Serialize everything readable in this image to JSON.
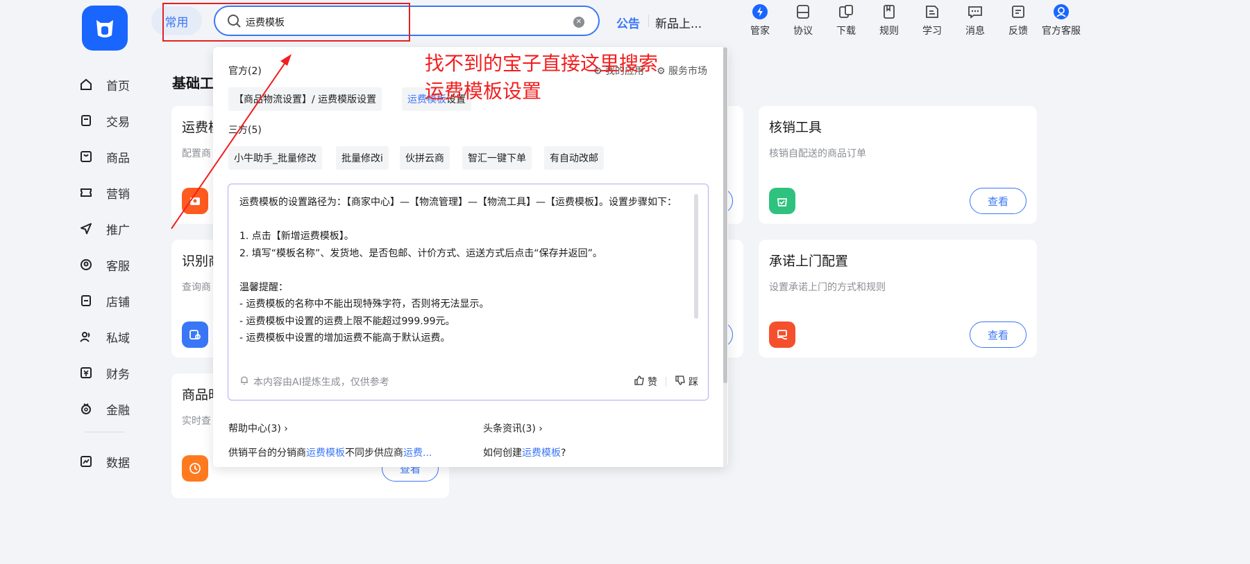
{
  "sidebar": {
    "items": [
      {
        "label": "首页",
        "icon": "home-icon"
      },
      {
        "label": "交易",
        "icon": "order-icon"
      },
      {
        "label": "商品",
        "icon": "product-icon"
      },
      {
        "label": "营销",
        "icon": "ticket-icon"
      },
      {
        "label": "推广",
        "icon": "send-icon"
      },
      {
        "label": "客服",
        "icon": "service-icon"
      },
      {
        "label": "店铺",
        "icon": "store-icon"
      },
      {
        "label": "私域",
        "icon": "people-icon"
      },
      {
        "label": "财务",
        "icon": "finance-icon"
      },
      {
        "label": "金融",
        "icon": "money-bag-icon"
      },
      {
        "label": "数据",
        "icon": "chart-icon"
      }
    ]
  },
  "topbar": {
    "common_tab": "常用",
    "search_value": "运费模板",
    "notice_label": "公告",
    "notice_text": "新品上...",
    "tools": [
      {
        "label": "管家",
        "icon": "butler-icon"
      },
      {
        "label": "协议",
        "icon": "agreement-icon"
      },
      {
        "label": "下载",
        "icon": "download-icon"
      },
      {
        "label": "规则",
        "icon": "rules-icon"
      },
      {
        "label": "学习",
        "icon": "learn-icon"
      },
      {
        "label": "消息",
        "icon": "message-icon"
      },
      {
        "label": "反馈",
        "icon": "feedback-icon"
      },
      {
        "label": "官方客服",
        "icon": "official-service-icon"
      }
    ]
  },
  "main": {
    "section_title": "基础工",
    "cards": [
      {
        "title": "运费模",
        "desc": "配置商",
        "button": "查看"
      },
      {
        "title": "识别商",
        "desc": "查询商",
        "button": "查看"
      },
      {
        "title": "商品时",
        "desc": "实时查",
        "button": "查看"
      },
      {
        "title": "核销工具",
        "desc": "核销自配送的商品订单",
        "button": "查看"
      },
      {
        "title": "承诺上门配置",
        "desc": "设置承诺上门的方式和规则",
        "button": "查看"
      }
    ]
  },
  "dropdown": {
    "official_group": "官方(2)",
    "my_apps_link": "我的应用",
    "service_market_link": "服务市场",
    "official_results": [
      "【商品物流设置】/ 运费模版设置",
      "设置"
    ],
    "official_result2_hl": "运费模板",
    "third_party_group": "三方(5)",
    "third_party_results": [
      "小牛助手_批量修改",
      "批量修改i",
      "伙拼云商",
      "智汇一键下单",
      "有自动改邮"
    ],
    "ai_answer": {
      "line1": "运费模板的设置路径为：【商家中心】—【物流管理】—【物流工具】—【运费模板】。设置步骤如下：",
      "step1": "1. 点击【新增运费模板】。",
      "step2": "2. 填写“模板名称”、发货地、是否包邮、计价方式、运送方式后点击“保存并返回”。",
      "tips_title": "温馨提醒：",
      "tip1": "- 运费模板的名称中不能出现特殊字符，否则将无法显示。",
      "tip2": "- 运费模板中设置的运费上限不能超过999.99元。",
      "tip3": "- 运费模板中设置的增加运费不能高于默认运费。",
      "footer": "本内容由AI提炼生成，仅供参考",
      "like": "赞",
      "dislike": "踩"
    },
    "help_center_title": "帮助中心(3)",
    "help_center_item_pre": "供销平台的分销商",
    "help_center_item_hl": "运费模板",
    "help_center_item_mid": "不同步供应商",
    "help_center_item_hl2": "运费...",
    "news_title": "头条资讯(3)",
    "news_item_pre": "如何创建",
    "news_item_hl": "运费模板",
    "news_item_post": "?"
  },
  "annotation": {
    "text_line1": "找不到的宝子直接这里搜索",
    "text_line2": "运费模板设置"
  },
  "colors": {
    "accent": "#3a77f7",
    "annotation": "#f21f1f"
  }
}
